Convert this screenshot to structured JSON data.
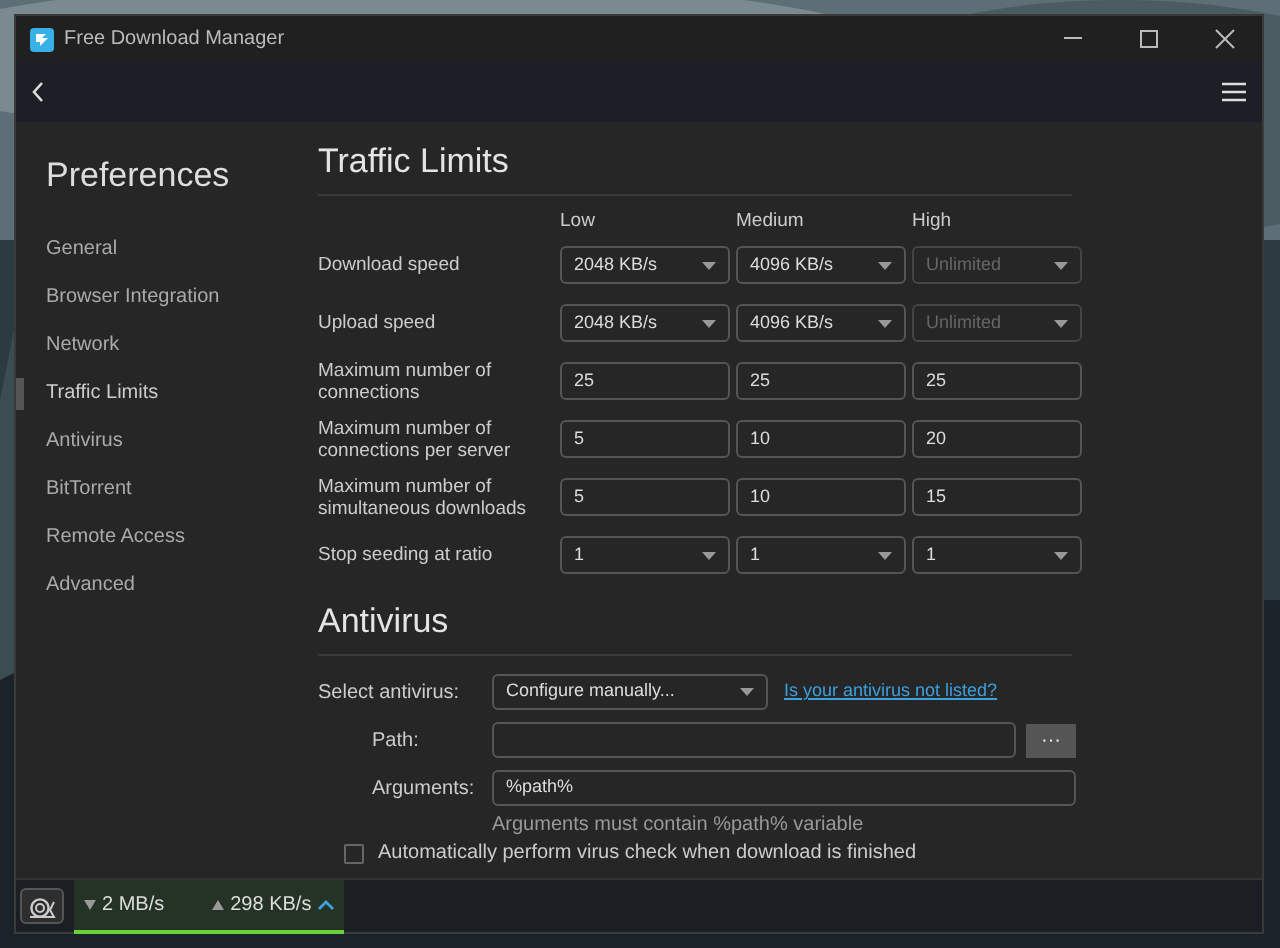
{
  "window": {
    "title": "Free Download Manager"
  },
  "sidebar": {
    "title": "Preferences",
    "items": [
      {
        "label": "General",
        "selected": false
      },
      {
        "label": "Browser Integration",
        "selected": false
      },
      {
        "label": "Network",
        "selected": false
      },
      {
        "label": "Traffic Limits",
        "selected": true
      },
      {
        "label": "Antivirus",
        "selected": false
      },
      {
        "label": "BitTorrent",
        "selected": false
      },
      {
        "label": "Remote Access",
        "selected": false
      },
      {
        "label": "Advanced",
        "selected": false
      }
    ]
  },
  "traffic_limits": {
    "title": "Traffic Limits",
    "columns": [
      "Low",
      "Medium",
      "High"
    ],
    "rows": [
      {
        "label": "Download speed",
        "kind": "select",
        "cells": [
          {
            "value": "2048 KB/s",
            "disabled": false
          },
          {
            "value": "4096 KB/s",
            "disabled": false
          },
          {
            "value": "Unlimited",
            "disabled": true
          }
        ]
      },
      {
        "label": "Upload speed",
        "kind": "select",
        "cells": [
          {
            "value": "2048 KB/s",
            "disabled": false
          },
          {
            "value": "4096 KB/s",
            "disabled": false
          },
          {
            "value": "Unlimited",
            "disabled": true
          }
        ]
      },
      {
        "label": "Maximum number of connections",
        "kind": "input",
        "cells": [
          {
            "value": "25",
            "disabled": false
          },
          {
            "value": "25",
            "disabled": false
          },
          {
            "value": "25",
            "disabled": false
          }
        ]
      },
      {
        "label": "Maximum number of connections per server",
        "kind": "input",
        "cells": [
          {
            "value": "5",
            "disabled": false
          },
          {
            "value": "10",
            "disabled": false
          },
          {
            "value": "20",
            "disabled": false
          }
        ]
      },
      {
        "label": "Maximum number of simultaneous downloads",
        "kind": "input",
        "cells": [
          {
            "value": "5",
            "disabled": false
          },
          {
            "value": "10",
            "disabled": false
          },
          {
            "value": "15",
            "disabled": false
          }
        ]
      },
      {
        "label": "Stop seeding at ratio",
        "kind": "select",
        "cells": [
          {
            "value": "1",
            "disabled": false
          },
          {
            "value": "1",
            "disabled": false
          },
          {
            "value": "1",
            "disabled": false
          }
        ]
      }
    ]
  },
  "antivirus": {
    "title": "Antivirus",
    "select_label": "Select antivirus:",
    "select_value": "Configure manually...",
    "link": "Is your antivirus not listed?",
    "path_label": "Path:",
    "browse_button": "···",
    "arguments_label": "Arguments:",
    "arguments_value": "%path%",
    "hint": "Arguments must contain %path% variable",
    "checkbox": {
      "label": "Automatically perform virus check when download is finished",
      "checked": false
    }
  },
  "status_bar": {
    "download": "2 MB/s",
    "upload": "298 KB/s"
  }
}
